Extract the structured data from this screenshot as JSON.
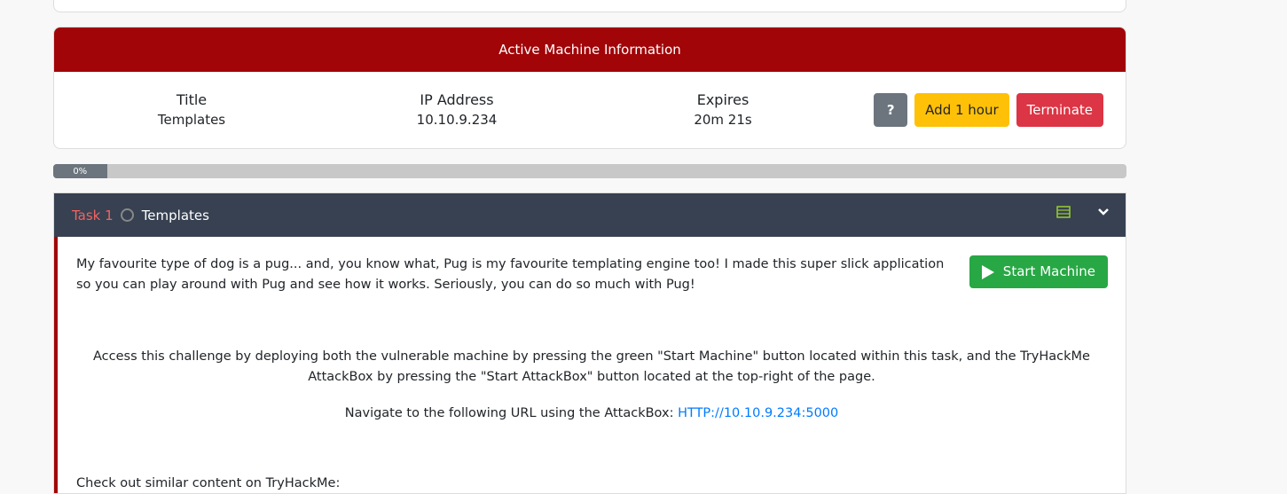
{
  "machine": {
    "header": "Active Machine Information",
    "title_label": "Title",
    "title_value": "Templates",
    "ip_label": "IP Address",
    "ip_value": "10.10.9.234",
    "expires_label": "Expires",
    "expires_value": "20m 21s",
    "help_label": "?",
    "add_hour_label": "Add 1 hour",
    "terminate_label": "Terminate"
  },
  "progress": {
    "percent": 0,
    "label": "0%"
  },
  "task": {
    "number": "Task 1",
    "title": "Templates",
    "status": "incomplete",
    "icons": [
      "server-icon",
      "chevron-down-icon"
    ],
    "intro": "My favourite type of dog is a pug... and, you know what, Pug is my favourite templating engine too! I made this super slick application so you can play around with Pug and see how it works. Seriously, you can do so much with Pug!",
    "start_machine_label": "Start Machine",
    "access_text": "Access this challenge by deploying both the vulnerable machine by pressing the green \"Start Machine\" button located within this task, and the TryHackMe AttackBox by pressing the  \"Start AttackBox\" button located at the top-right of the page.",
    "navigate_text": "Navigate to the following URL using the AttackBox: ",
    "url": "HTTP://10.10.9.234:5000",
    "similar_text": "Check out similar content on TryHackMe:"
  },
  "colors": {
    "header_red": "#a10508",
    "task_header": "#374151",
    "green": "#28a745",
    "yellow": "#ffc107",
    "red": "#dc3545"
  }
}
